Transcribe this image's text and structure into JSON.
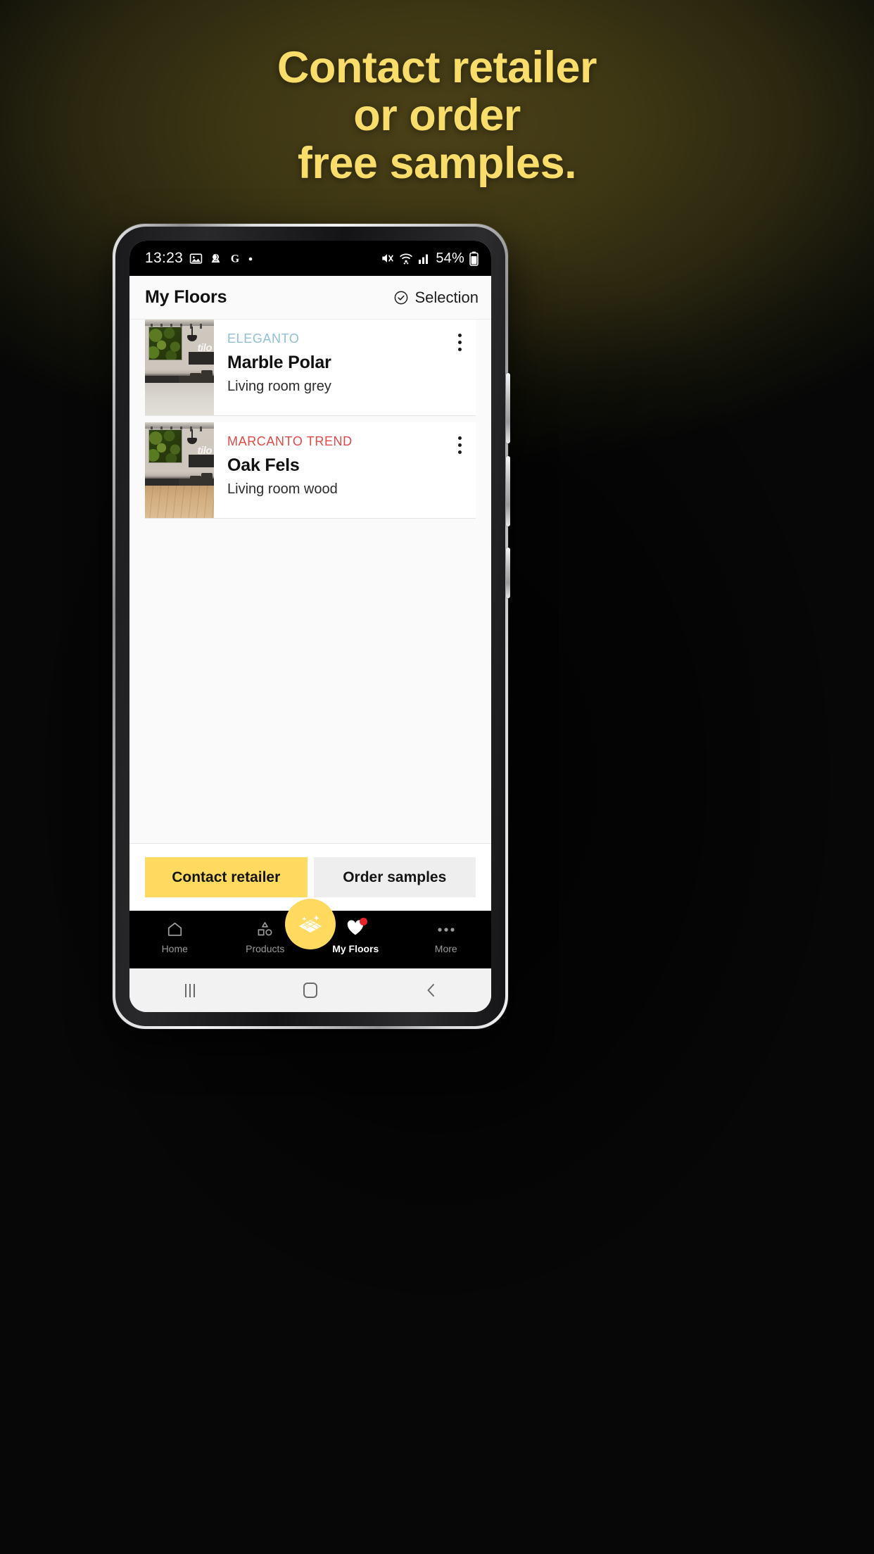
{
  "headline": {
    "line1": "Contact retailer",
    "line2": "or order",
    "line3": "free samples.",
    "color": "#f8dd6b"
  },
  "status_bar": {
    "time": "13:23",
    "left_icons": [
      "image-icon",
      "screen-record-icon",
      "google-icon",
      "dot-icon"
    ],
    "right_icons": [
      "mute-icon",
      "wifi-icon",
      "signal-icon"
    ],
    "battery_percent": "54%",
    "battery_icon": "battery-icon"
  },
  "app_header": {
    "title": "My Floors",
    "selection_label": "Selection",
    "selection_icon": "check-circle-icon"
  },
  "list": {
    "items": [
      {
        "brand": "ELEGANTO",
        "brand_color": "#8fc0d9",
        "name": "Marble Polar",
        "subtitle": "Living room grey",
        "thumbnail_logo": "tilo",
        "floor_tone": "grey",
        "menu_icon": "kebab-menu-icon"
      },
      {
        "brand": "MARCANTO TREND",
        "brand_color": "#e04a46",
        "name": "Oak Fels",
        "subtitle": "Living room wood",
        "thumbnail_logo": "tilo",
        "floor_tone": "wood",
        "menu_icon": "kebab-menu-icon"
      }
    ]
  },
  "action_bar": {
    "primary_label": "Contact retailer",
    "primary_color": "#ffda5e",
    "secondary_label": "Order samples",
    "secondary_color": "#eeeeee"
  },
  "bottom_nav": {
    "items": [
      {
        "label": "Home",
        "icon": "home-icon",
        "active": false
      },
      {
        "label": "Products",
        "icon": "shapes-icon",
        "active": false
      },
      {
        "label": "My Floors",
        "icon": "heart-icon",
        "active": true,
        "badge": true
      },
      {
        "label": "More",
        "icon": "ellipsis-icon",
        "active": false
      }
    ],
    "fab_icon": "floor-tiles-sparkle-icon",
    "fab_color": "#ffda5e"
  },
  "system_nav": {
    "recents_icon": "recents-icon",
    "home_icon": "home-square-icon",
    "back_icon": "back-chevron-icon"
  }
}
